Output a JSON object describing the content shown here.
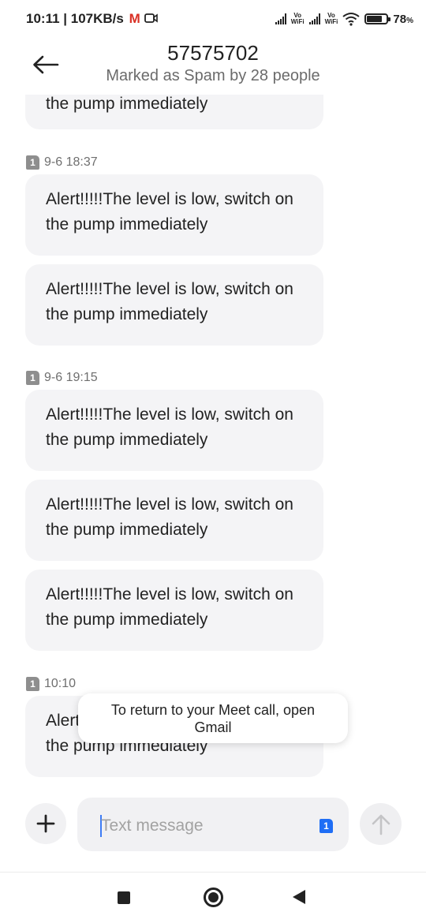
{
  "status_bar": {
    "time": "10:11",
    "network_speed": "107KB/s",
    "gmail_icon": "gmail-icon",
    "meet_icon": "video-call-icon",
    "vowifi_label_top": "Vo",
    "vowifi_label_bottom": "WiFi",
    "battery_percent": "78",
    "battery_unit": "%",
    "battery_level": 0.78
  },
  "header": {
    "title": "57575702",
    "subtitle": "Marked as Spam by 28 people"
  },
  "messages": {
    "partial_message": "the pump immediately",
    "groups": [
      {
        "sim": "1",
        "timestamp": "9-6 18:37",
        "messages": [
          "Alert!!!!!The level is low, switch on the pump immediately",
          "Alert!!!!!The level is low, switch on the pump immediately"
        ]
      },
      {
        "sim": "1",
        "timestamp": "9-6 19:15",
        "messages": [
          "Alert!!!!!The level is low, switch on the pump immediately",
          "Alert!!!!!The level is low, switch on the pump immediately",
          "Alert!!!!!The level is low, switch on the pump immediately"
        ]
      },
      {
        "sim": "1",
        "timestamp": "10:10",
        "messages": [
          "Alert!!!!!The level is low, switch on the pump immediately"
        ]
      }
    ]
  },
  "toast": {
    "text": "To return to your Meet call, open Gmail"
  },
  "composer": {
    "placeholder": "Text message",
    "sim": "1"
  }
}
